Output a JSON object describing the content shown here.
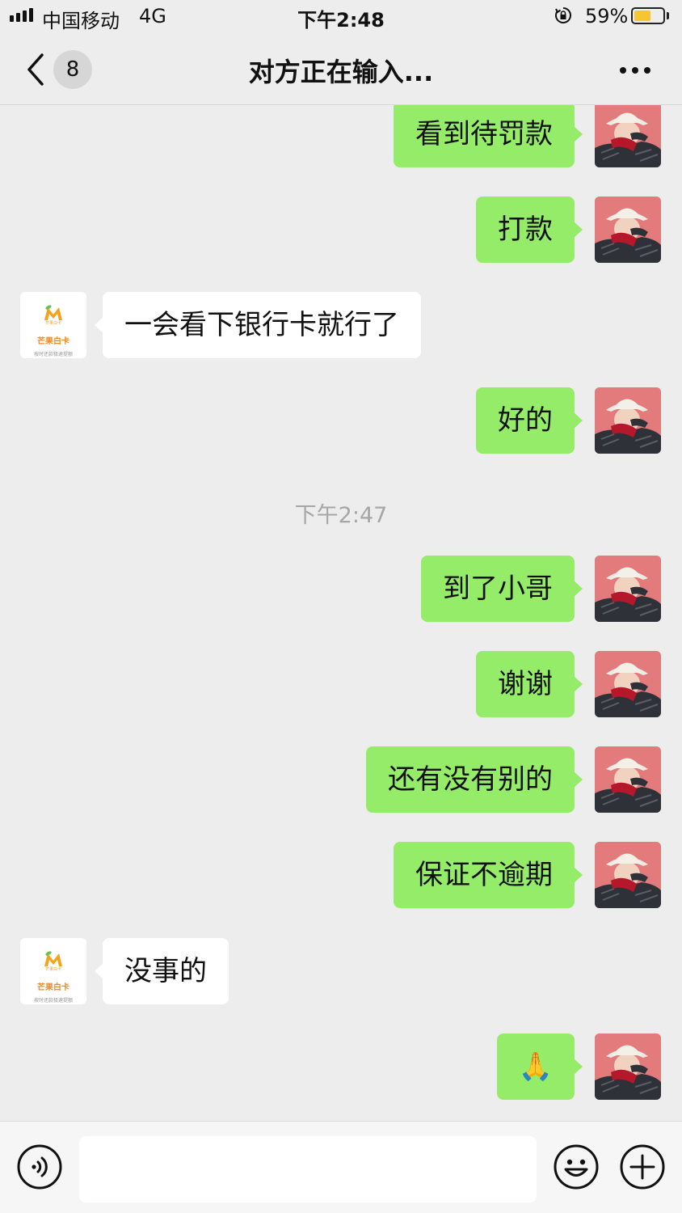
{
  "status_bar": {
    "carrier": "中国移动",
    "network": "4G",
    "time": "下午2:48",
    "battery_percent": "59%",
    "battery_level": 0.59,
    "battery_color": "#f7c531"
  },
  "header": {
    "unread_count": "8",
    "title": "对方正在输入..."
  },
  "peer_logo": {
    "brand_small": "芒果白卡",
    "name": "芒果白卡",
    "slogan": "按时还款极速提额"
  },
  "messages": [
    {
      "direction": "out",
      "text": "看到待罚款"
    },
    {
      "direction": "out",
      "text": "打款"
    },
    {
      "direction": "in",
      "text": "一会看下银行卡就行了"
    },
    {
      "direction": "out",
      "text": "好的"
    },
    {
      "timestamp": "下午2:47"
    },
    {
      "direction": "out",
      "text": "到了小哥"
    },
    {
      "direction": "out",
      "text": "谢谢"
    },
    {
      "direction": "out",
      "text": "还有没有别的"
    },
    {
      "direction": "out",
      "text": "保证不逾期"
    },
    {
      "direction": "in",
      "text": "没事的"
    },
    {
      "direction": "out",
      "text": "🙏"
    }
  ],
  "input": {
    "value": "",
    "placeholder": ""
  },
  "colors": {
    "background": "#ededed",
    "outgoing_bubble": "#95ec69",
    "incoming_bubble": "#ffffff",
    "user_avatar": "#e37b7c"
  },
  "icons": {
    "back": "chevron-left-icon",
    "more": "ellipsis-icon",
    "voice": "voice-icon",
    "emoji": "smiley-icon",
    "plus": "plus-icon",
    "rotation_lock": "rotation-lock-icon"
  }
}
